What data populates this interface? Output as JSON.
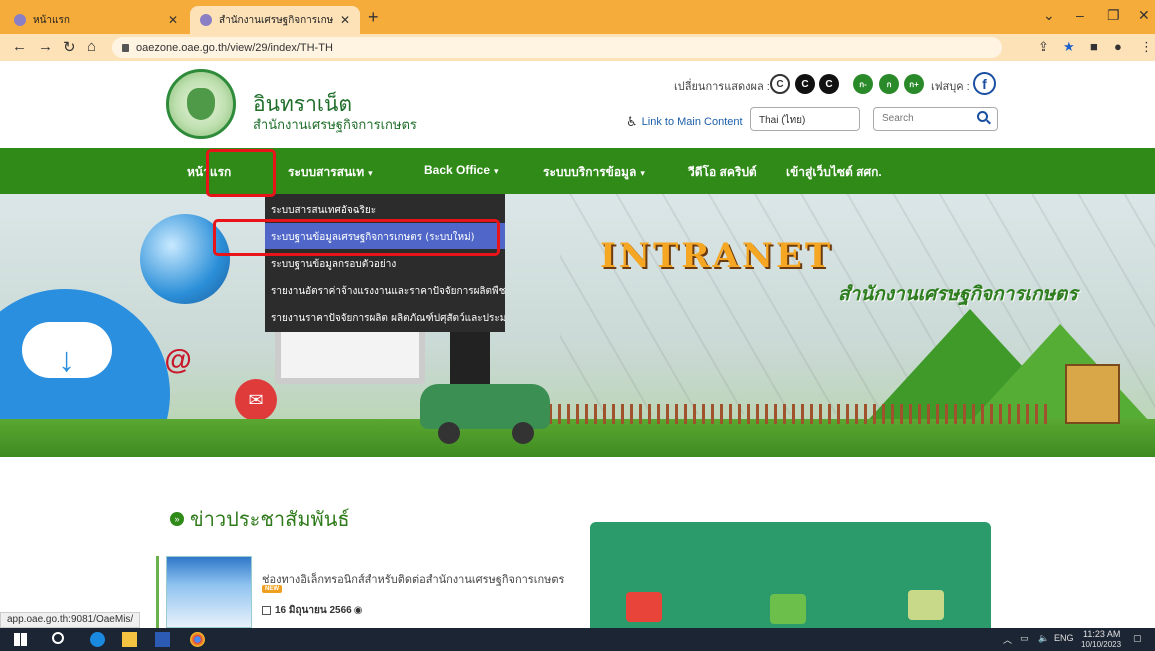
{
  "browser": {
    "tabs": [
      {
        "label": "หน้าแรก",
        "active": false
      },
      {
        "label": "สำนักงานเศรษฐกิจการเกษตร",
        "active": true
      }
    ],
    "url": "oaezone.oae.go.th/view/29/index/TH-TH",
    "status_url": "app.oae.go.th:9081/OaeMis/"
  },
  "header": {
    "title": "อินทราเน็ต",
    "subtitle": "สำนักงานเศรษฐกิจการเกษตร",
    "display_label": "เปลี่ยนการแสดงผล :",
    "contrast_buttons": [
      "C",
      "C",
      "C"
    ],
    "font_buttons": [
      "ก-",
      "ก",
      "ก+"
    ],
    "facebook_label": "เฟสบุค :",
    "main_content_link": "Link to Main Content",
    "language": "Thai (ไทย)",
    "search_placeholder": "Search"
  },
  "nav": {
    "items": [
      {
        "label": "หน้าแรก",
        "caret": false
      },
      {
        "label": "ระบบสารสนเท",
        "caret": true
      },
      {
        "label": "Back Office",
        "caret": true
      },
      {
        "label": "ระบบบริการข้อมูล",
        "caret": true
      },
      {
        "label": "วีดีโอ สคริปต์",
        "caret": false
      },
      {
        "label": "เข้าสู่เว็บไซต์ สศก.",
        "caret": false
      }
    ],
    "dropdown": [
      "ระบบสารสนเทศอัจฉริยะ",
      "ระบบฐานข้อมูลเศรษฐกิจการเกษตร (ระบบใหม่)",
      "ระบบฐานข้อมูลกรอบตัวอย่าง",
      "รายงานอัตราค่าจ้างแรงงานและราคาปัจจัยการผลิตพืช",
      "รายงานราคาปัจจัยการผลิต ผลิตภัณฑ์ปศุสัตว์และประมง"
    ]
  },
  "banner": {
    "title": "INTRANET",
    "subtitle": "สำนักงานเศรษฐกิจการเกษตร"
  },
  "news": {
    "heading": "ข่าวประชาสัมพันธ์",
    "items": [
      {
        "title": "ช่องทางอิเล็กทรอนิกส์สำหรับติดต่อสำนักงานเศรษฐกิจการเกษตร",
        "badge": "NEW",
        "date": "16 มิถุนายน 2566"
      }
    ]
  },
  "taskbar": {
    "lang": "ENG",
    "time": "11:23 AM",
    "date": "10/10/2023"
  },
  "colors": {
    "nav_green": "#2f8a18",
    "dropdown_highlight": "#5067c9",
    "annotation_red": "#e8141a",
    "tab_orange": "#f5ac3a"
  }
}
